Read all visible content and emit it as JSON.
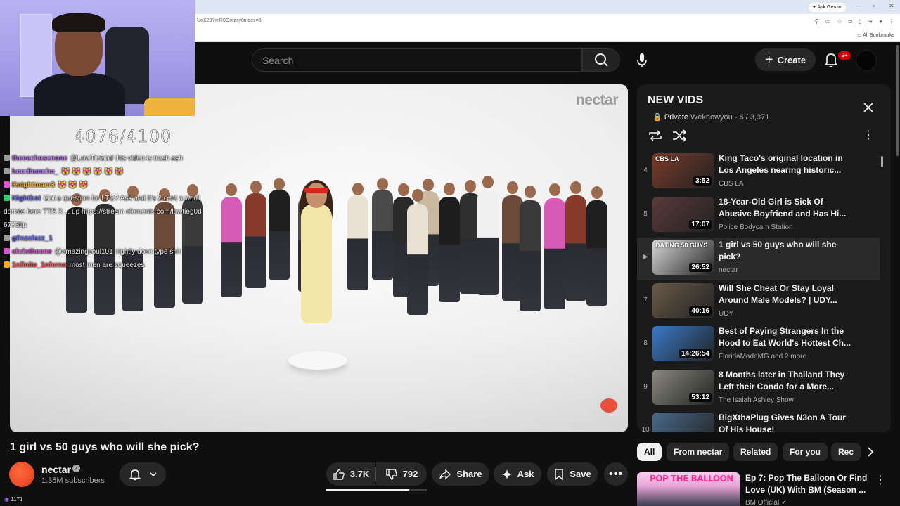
{
  "browser": {
    "url": "UqX29YmR0Oorzsy8index=6",
    "ask_gemini": "Ask Gemini",
    "all_bookmarks": "All Bookmarks"
  },
  "stream_overlay": {
    "counter": "4076/4100",
    "viewer_count": "1171",
    "chat": [
      {
        "user": "theeechosenone",
        "message": "@LowTieGod this video is trash ash",
        "color": "#c67af5",
        "badge_color": "#9b9b9b"
      },
      {
        "user": "hoodhuncho_",
        "message": "😻 😻 😻 😻 😻 😻",
        "color": "#c67af5",
        "badge_color": "#9b9b9b"
      },
      {
        "user": "Knightmaer3",
        "message": "😻 😻 😻",
        "color": "#f5a623",
        "badge_color": "#e14fd8"
      },
      {
        "user": "Nightbot",
        "message": "Got a question for LTG? Ask and it's 2 cent a word",
        "color": "#6f6ff5",
        "badge_color": "#2ecc71"
      },
      {
        "user": "",
        "message": "donate here TTS 3 ... up https://stream elements com/lowtieg0d",
        "color": "#ffffff",
        "badge_color": ""
      },
      {
        "user": "",
        "message": "6773tip",
        "color": "#ffffff",
        "badge_color": ""
      },
      {
        "user": "g0nzalezz_1",
        "message": "",
        "color": "#6f6ff5",
        "badge_color": "#9b9b9b"
      },
      {
        "user": "christheone",
        "message": "@amazingsoul101 nightly dose type shit",
        "color": "#e14fd8",
        "badge_color": "#e14fd8"
      },
      {
        "user": "1nfinite_1nferno",
        "message": "most men are squeezes",
        "color": "#ff4d4d",
        "badge_color": "#f5a623"
      }
    ]
  },
  "header": {
    "search_placeholder": "Search",
    "create_label": "Create",
    "notification_count": "9+"
  },
  "video": {
    "watermark": "nectar",
    "title": "1 girl vs 50 guys who will she pick?",
    "channel": "nectar",
    "subscribers": "1.35M subscribers",
    "likes": "3.7K",
    "dislikes": "792",
    "like_ratio": 0.82,
    "share_label": "Share",
    "ask_label": "Ask",
    "save_label": "Save"
  },
  "playlist": {
    "title": "NEW VIDS",
    "privacy": "Private",
    "owner": "Weknowyou",
    "position": "6 / 3,371",
    "items": [
      {
        "index": "4",
        "title": "King Taco's original location in Los Angeles nearing historic...",
        "channel": "CBS LA",
        "duration": "3:52",
        "thumb_color": "#7a3b2a",
        "thumb_label": "CBS LA",
        "current": false
      },
      {
        "index": "5",
        "title": "18-Year-Old Girl is Sick Of Abusive Boyfriend and Has Hi...",
        "channel": "Police Bodycam Station",
        "duration": "17:07",
        "thumb_color": "#5b3a3a",
        "thumb_label": "",
        "current": false
      },
      {
        "index": "▶",
        "title": "1 girl vs 50 guys who will she pick?",
        "channel": "nectar",
        "duration": "26:52",
        "thumb_color": "#d9d9d9",
        "thumb_label": "DATING 50 GUYS",
        "current": true
      },
      {
        "index": "7",
        "title": "Will She Cheat Or Stay Loyal Around Male Models? | UDY...",
        "channel": "UDY",
        "duration": "40:16",
        "thumb_color": "#6a5a48",
        "thumb_label": "",
        "current": false
      },
      {
        "index": "8",
        "title": "Best of Paying Strangers In the Hood to Eat World's Hottest Ch...",
        "channel": "FloridaMadeMG and 2 more",
        "duration": "14:26:54",
        "thumb_color": "#3a7ac8",
        "thumb_label": "",
        "current": false
      },
      {
        "index": "9",
        "title": "8 Months later in Thailand They Left their Condo for a More...",
        "channel": "The Isaiah Ashley Show",
        "duration": "53:12",
        "thumb_color": "#8a8a80",
        "thumb_label": "",
        "current": false
      },
      {
        "index": "10",
        "title": "BigXthaPlug Gives N3on A Tour Of His House!",
        "channel": "",
        "duration": "",
        "thumb_color": "#4a6a8a",
        "thumb_label": "",
        "current": false
      }
    ]
  },
  "chips": [
    "All",
    "From nectar",
    "Related",
    "For you",
    "Rec"
  ],
  "recommendation": {
    "thumb_label": "POP THE BALLOON",
    "title": "Ep 7: Pop The Balloon Or Find Love (UK) With BM (Season ...",
    "channel": "BM Official"
  }
}
